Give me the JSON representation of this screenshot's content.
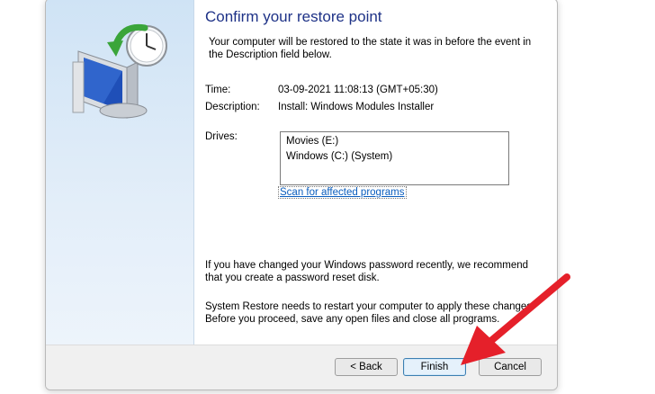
{
  "wizard": {
    "heading": "Confirm your restore point",
    "intro": "Your computer will be restored to the state it was in before the event in the Description field below.",
    "time_label": "Time:",
    "time_value": "03-09-2021 11:08:13 (GMT+05:30)",
    "description_label": "Description:",
    "description_value": "Install: Windows Modules Installer",
    "drives_label": "Drives:",
    "drives": [
      "Movies (E:)",
      "Windows (C:) (System)"
    ],
    "scan_link": "Scan for affected programs",
    "password_note": "If you have changed your Windows password recently, we recommend that you create a password reset disk.",
    "restart_note": "System Restore needs to restart your computer to apply these changes. Before you proceed, save any open files and close all programs."
  },
  "buttons": {
    "back": "< Back",
    "finish": "Finish",
    "cancel": "Cancel"
  },
  "colors": {
    "heading": "#1e3287",
    "link": "#0a5dbe",
    "annotation_arrow": "#e5202a"
  },
  "icons": {
    "illustration": "system-restore-icon",
    "annotation": "red-pointer-arrow"
  }
}
